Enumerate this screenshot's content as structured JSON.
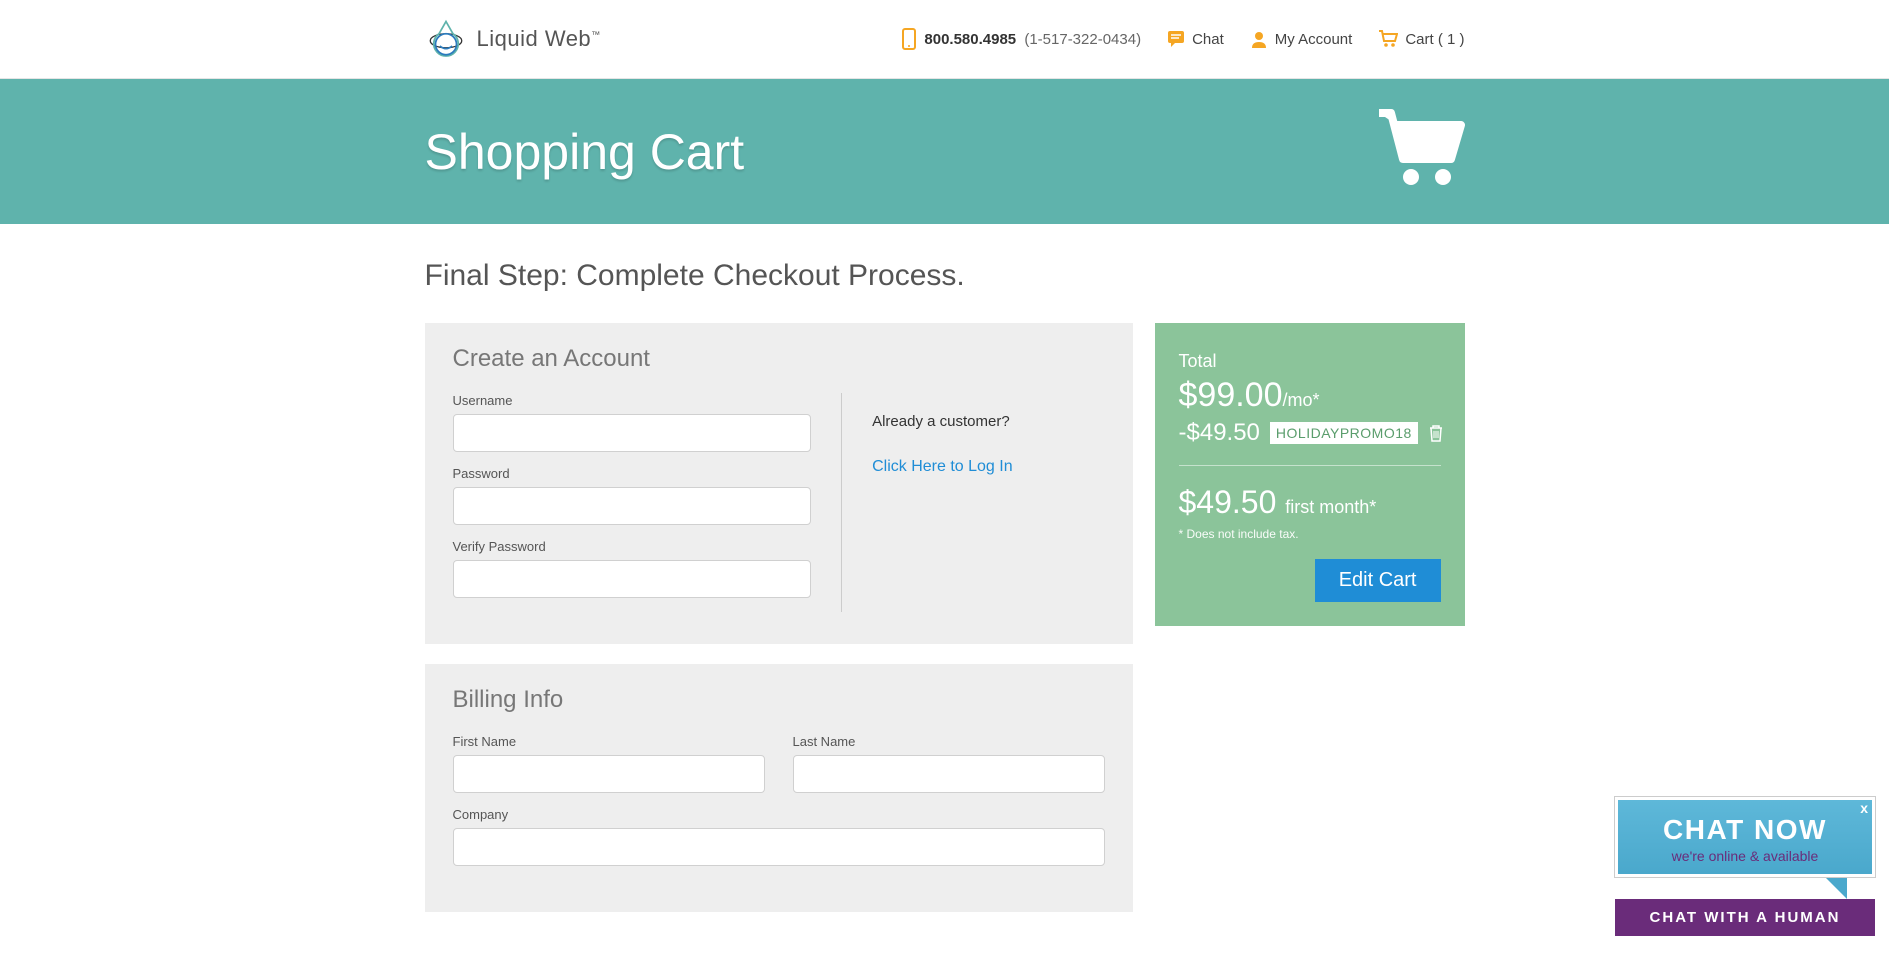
{
  "header": {
    "brand_name": "Liquid Web",
    "brand_tm": "™",
    "phone_main": "800.580.4985",
    "phone_alt": "(1-517-322-0434)",
    "chat_label": "Chat",
    "account_label": "My Account",
    "cart_label": "Cart ( 1 )"
  },
  "banner": {
    "title": "Shopping Cart"
  },
  "page": {
    "title": "Final Step: Complete Checkout Process."
  },
  "create_account": {
    "heading": "Create an Account",
    "username_label": "Username",
    "password_label": "Password",
    "verify_password_label": "Verify Password",
    "already_customer": "Already a customer?",
    "login_link": "Click Here to Log In"
  },
  "billing": {
    "heading": "Billing Info",
    "first_name_label": "First Name",
    "last_name_label": "Last Name",
    "company_label": "Company"
  },
  "summary": {
    "total_label": "Total",
    "total_amount": "$99.00",
    "total_per": "/mo*",
    "discount_amount": "-$49.50",
    "promo_code": "HOLIDAYPROMO18",
    "final_amount": "$49.50",
    "final_suffix": "first month*",
    "tax_note": "* Does not include tax.",
    "edit_cart": "Edit Cart"
  },
  "chat": {
    "now_title": "CHAT NOW",
    "now_sub": "we're online & available",
    "close": "x",
    "human": "CHAT WITH A HUMAN"
  }
}
